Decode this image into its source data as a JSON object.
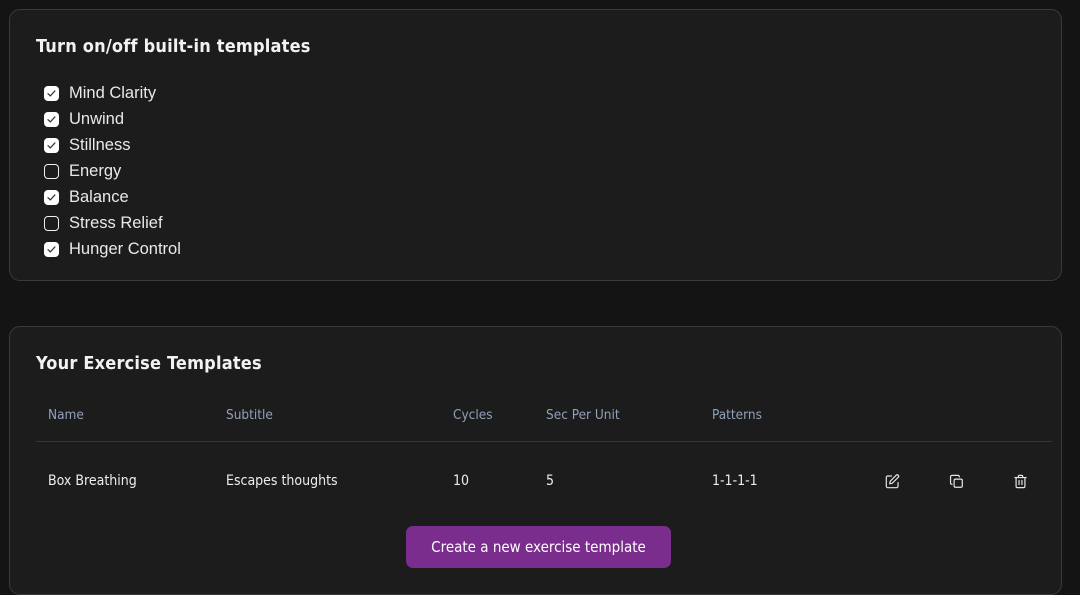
{
  "theme": {
    "page_bg": "#141414",
    "card_bg": "#1c1c1c",
    "card_border": "#3a3a3a",
    "accent_purple": "#7b2d8e",
    "header_text": "#93a0bb",
    "divider": "#2e3747",
    "text": "#ededed"
  },
  "templates_card": {
    "title": "Turn on/off built-in templates",
    "items": [
      {
        "label": "Mind Clarity",
        "checked": true,
        "icon": "checkbox-checked-icon"
      },
      {
        "label": "Unwind",
        "checked": true,
        "icon": "checkbox-checked-icon"
      },
      {
        "label": "Stillness",
        "checked": true,
        "icon": "checkbox-checked-icon"
      },
      {
        "label": "Energy",
        "checked": false,
        "icon": "checkbox-unchecked-icon"
      },
      {
        "label": "Balance",
        "checked": true,
        "icon": "checkbox-checked-icon"
      },
      {
        "label": "Stress Relief",
        "checked": false,
        "icon": "checkbox-unchecked-icon"
      },
      {
        "label": "Hunger Control",
        "checked": true,
        "icon": "checkbox-checked-icon"
      }
    ]
  },
  "exercises_card": {
    "title": "Your Exercise Templates",
    "columns": [
      "Name",
      "Subtitle",
      "Cycles",
      "Sec Per Unit",
      "Patterns"
    ],
    "rows": [
      {
        "name": "Box Breathing",
        "subtitle": "Escapes thoughts",
        "cycles": "10",
        "sec_per_unit": "5",
        "patterns": "1-1-1-1",
        "actions": [
          "edit-icon",
          "duplicate-icon",
          "delete-icon"
        ]
      }
    ],
    "create_button_label": "Create a new exercise template"
  }
}
